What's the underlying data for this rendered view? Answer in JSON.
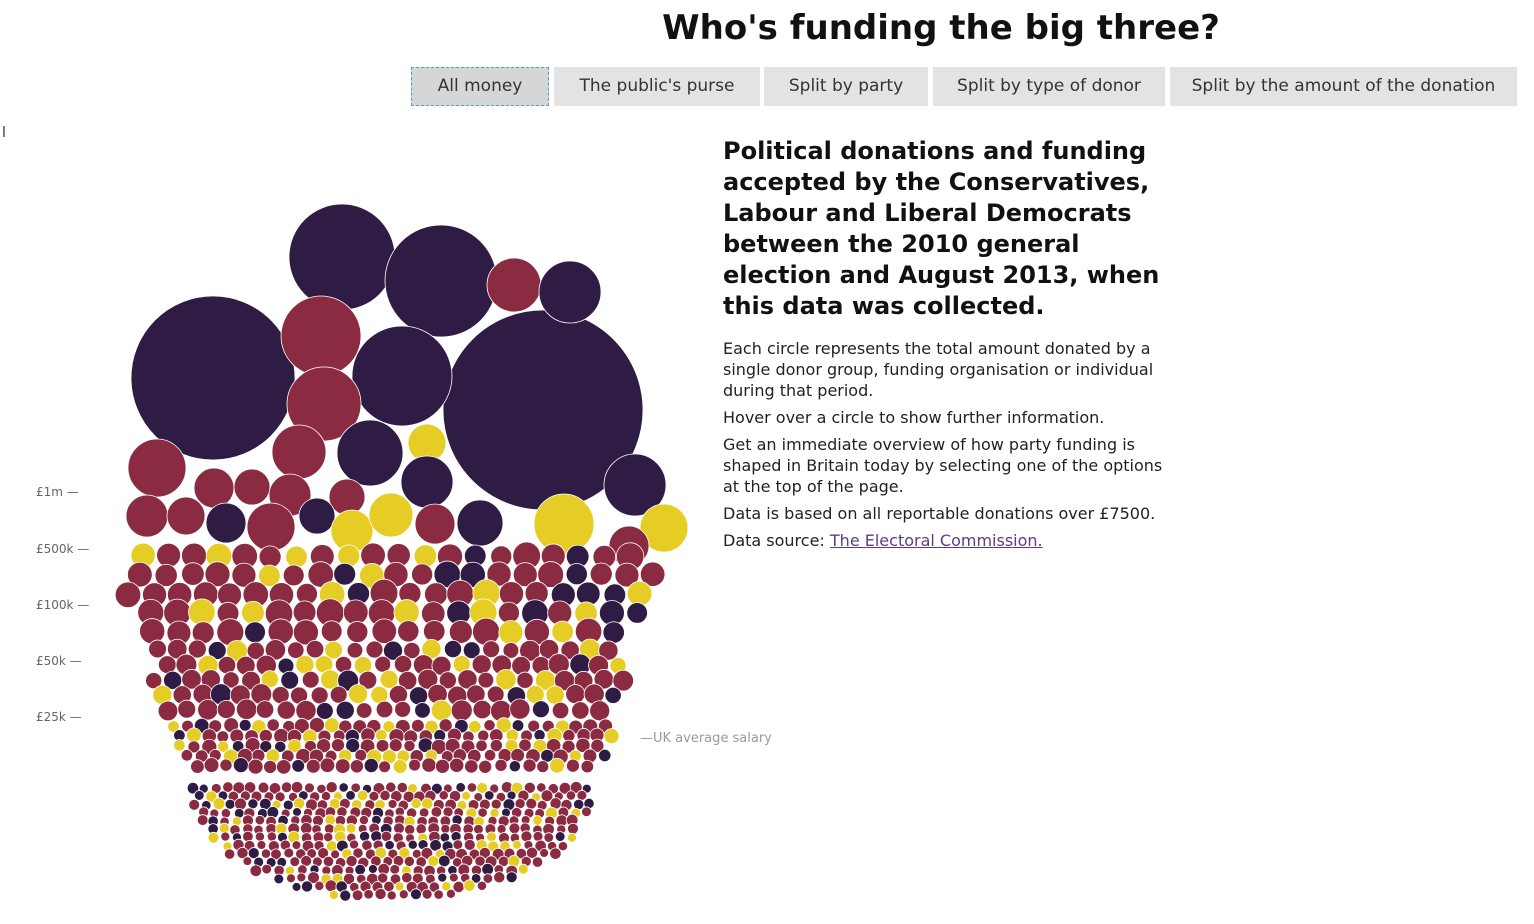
{
  "page": {
    "title": "Who's funding the big three?",
    "stray_glyph": "l"
  },
  "tabs": [
    {
      "label": "All money",
      "active": true
    },
    {
      "label": "The public's purse",
      "active": false
    },
    {
      "label": "Split by party",
      "active": false
    },
    {
      "label": "Split by type of donor",
      "active": false
    },
    {
      "label": "Split by the amount of the donation",
      "active": false
    }
  ],
  "info": {
    "heading": "Political donations and funding accepted by the Conservatives, Labour and Liberal Democrats between the 2010 general election and August 2013, when this data was collected.",
    "para_1": "Each circle represents the total amount donated by a single donor group, funding organisation or individual during that period.",
    "para_2": "Hover over a circle to show further information.",
    "para_3": "Get an immediate overview of how party funding is shaped in Britain today by selecting one of the options at the top of the page.",
    "para_4": "Data is based on all reportable donations over £7500.",
    "source_prefix": "Data source: ",
    "source_link": "The Electoral Commission."
  },
  "scale": {
    "labels": [
      "£1m —",
      "£500k —",
      "£100k —",
      "£50k —",
      "£25k —"
    ],
    "salary_label": "—UK average salary"
  },
  "colors": {
    "dark_purple": "#2e1c45",
    "maroon": "#8b2b42",
    "yellow": "#e6cd26",
    "background": "#ffffff"
  }
}
